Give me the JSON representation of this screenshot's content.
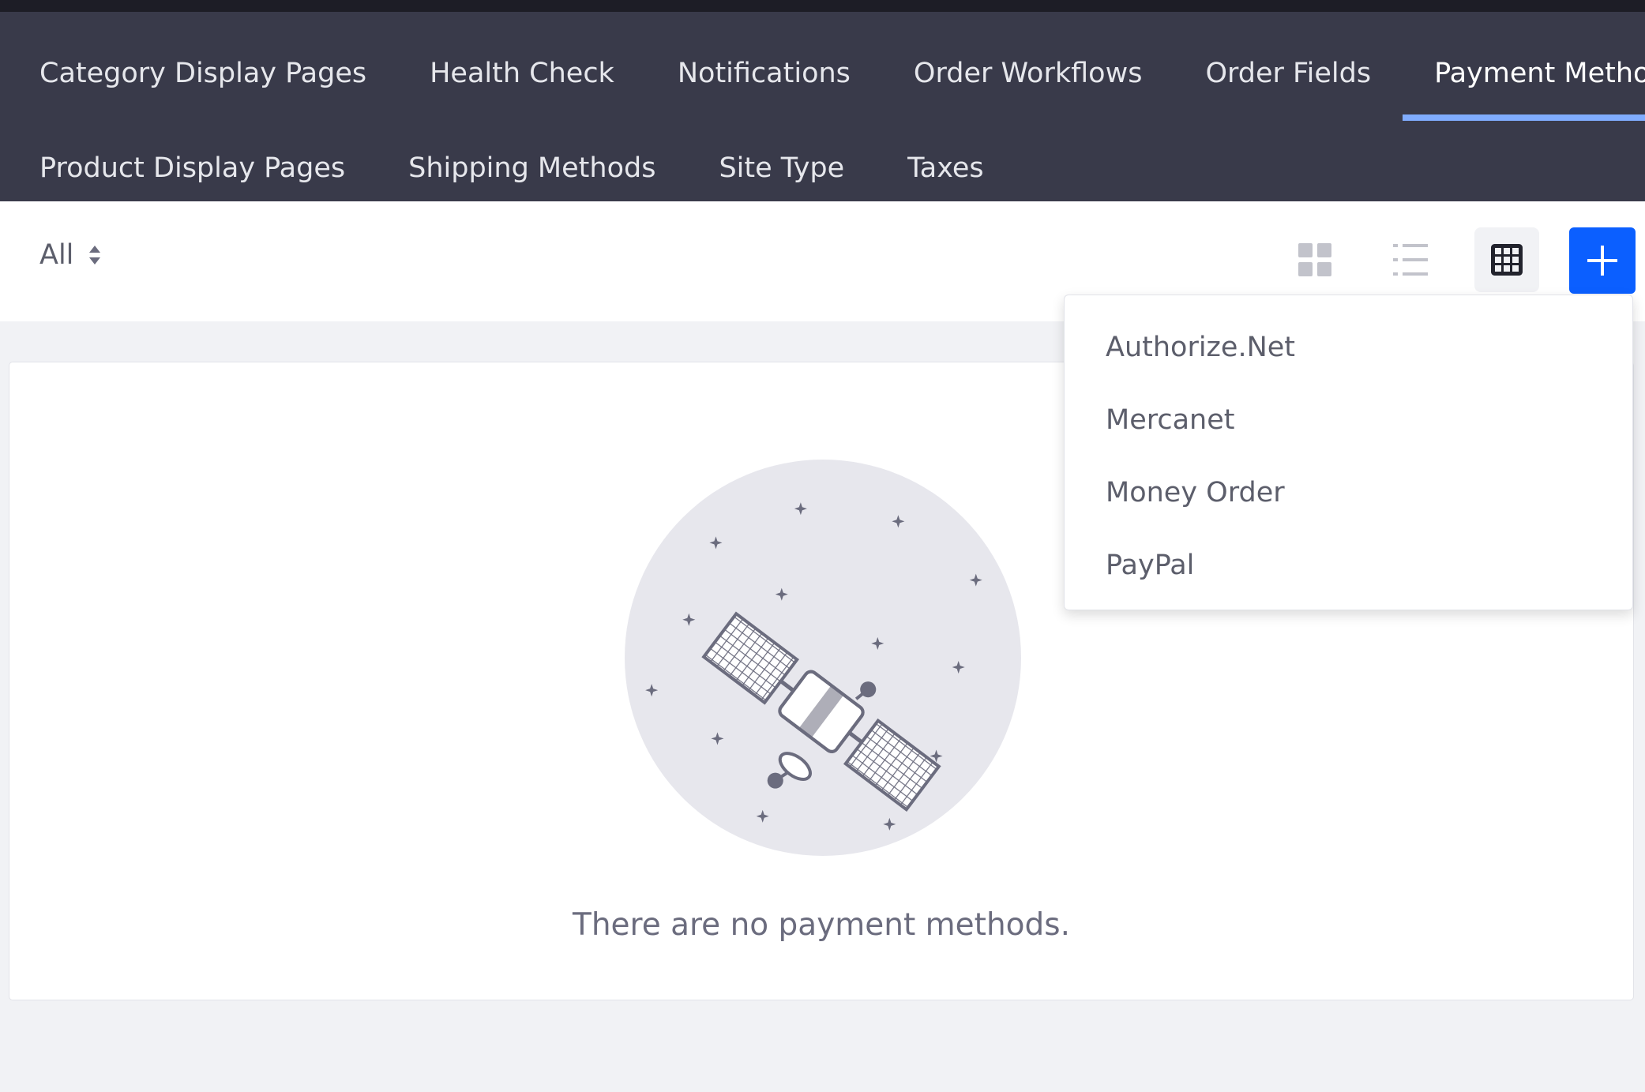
{
  "nav": {
    "row1": [
      {
        "label": "Category Display Pages",
        "active": false
      },
      {
        "label": "Health Check",
        "active": false
      },
      {
        "label": "Notifications",
        "active": false
      },
      {
        "label": "Order Workflows",
        "active": false
      },
      {
        "label": "Order Fields",
        "active": false
      },
      {
        "label": "Payment Methods",
        "active": true
      }
    ],
    "row2": [
      {
        "label": "Product Display Pages",
        "active": false
      },
      {
        "label": "Shipping Methods",
        "active": false
      },
      {
        "label": "Site Type",
        "active": false
      },
      {
        "label": "Taxes",
        "active": false
      }
    ]
  },
  "toolbar": {
    "filter_label": "All",
    "filter_icon": "sort-icon",
    "view_buttons": [
      "cards-view-icon",
      "list-view-icon",
      "table-view-icon"
    ],
    "active_view": "table",
    "add_icon": "plus-icon"
  },
  "add_menu": {
    "items": [
      "Authorize.Net",
      "Mercanet",
      "Money Order",
      "PayPal"
    ]
  },
  "empty_state": {
    "illustration": "satellite-icon",
    "message": "There are no payment methods."
  },
  "colors": {
    "nav_background": "#393a4a",
    "active_tab_indicator": "#80acff",
    "primary_button": "#0b5fff",
    "page_background": "#f1f2f5"
  }
}
